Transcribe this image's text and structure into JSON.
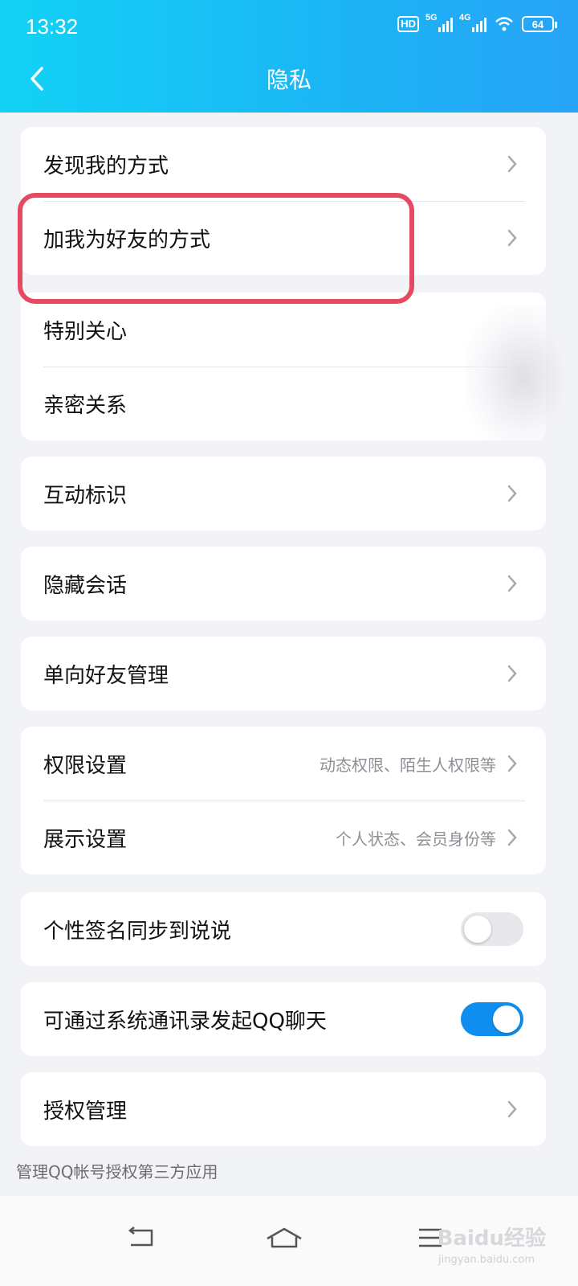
{
  "status_bar": {
    "time": "13:32",
    "hd": "HD",
    "net1": "5G",
    "net2": "4G",
    "battery": "64",
    "icons": [
      "hd-icon",
      "signal-5g-icon",
      "signal-4g-icon",
      "wifi-icon",
      "battery-icon"
    ]
  },
  "header": {
    "title": "隐私",
    "back_icon": "chevron-left-icon"
  },
  "groups": [
    {
      "rows": [
        {
          "label": "发现我的方式"
        },
        {
          "label": "加我为好友的方式"
        }
      ]
    },
    {
      "rows": [
        {
          "label": "特别关心"
        },
        {
          "label": "亲密关系"
        }
      ]
    },
    {
      "rows": [
        {
          "label": "互动标识"
        }
      ]
    },
    {
      "rows": [
        {
          "label": "隐藏会话"
        }
      ]
    },
    {
      "rows": [
        {
          "label": "单向好友管理"
        }
      ]
    },
    {
      "rows": [
        {
          "label": "权限设置",
          "value": "动态权限、陌生人权限等"
        },
        {
          "label": "展示设置",
          "value": "个人状态、会员身份等"
        }
      ]
    },
    {
      "rows": [
        {
          "label": "个性签名同步到说说",
          "toggle": false
        }
      ]
    },
    {
      "rows": [
        {
          "label": "可通过系统通讯录发起QQ聊天",
          "toggle": true
        }
      ]
    },
    {
      "rows": [
        {
          "label": "授权管理"
        }
      ]
    }
  ],
  "footnote": "管理QQ帐号授权第三方应用",
  "nav_bar": {
    "icons": [
      "back-nav-icon",
      "home-nav-icon",
      "menu-nav-icon"
    ]
  },
  "watermark": {
    "text": "Baidu经验",
    "sub": "jingyan.baidu.com"
  },
  "colors": {
    "header_start": "#12d2f5",
    "header_end": "#27a4f6",
    "toggle_on": "#0e8ff0",
    "highlight": "#e64a63"
  }
}
